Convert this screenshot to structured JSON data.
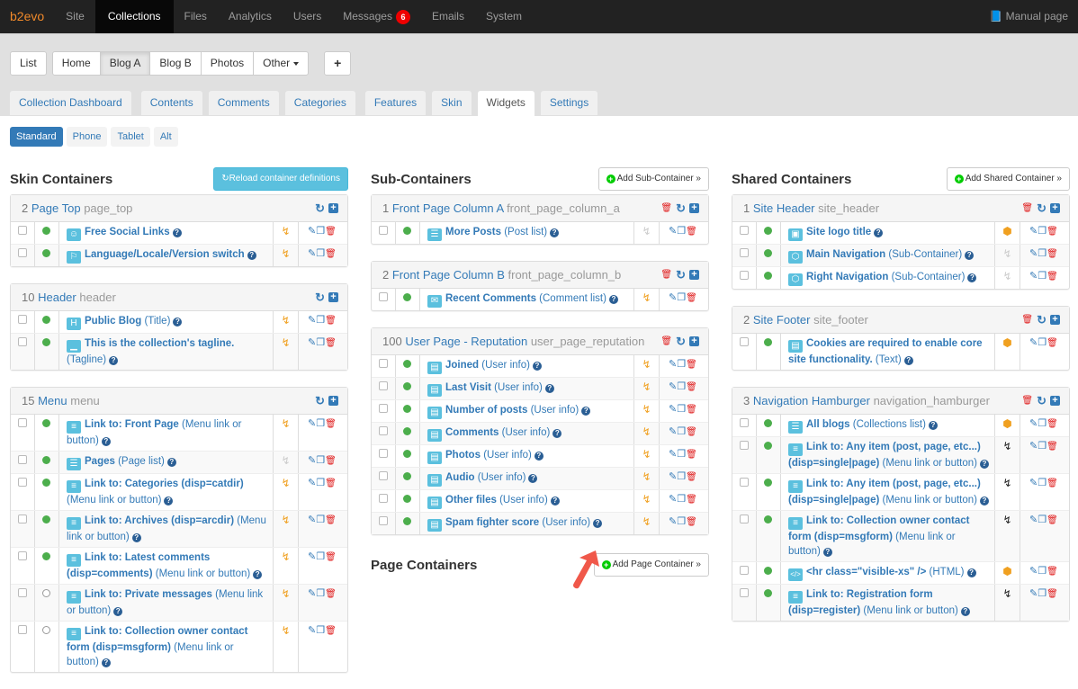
{
  "topnav": {
    "brand": "b2evo",
    "items": [
      {
        "label": "Site"
      },
      {
        "label": "Collections",
        "active": true
      },
      {
        "label": "Files"
      },
      {
        "label": "Analytics"
      },
      {
        "label": "Users"
      },
      {
        "label": "Messages",
        "badge": "6"
      },
      {
        "label": "Emails"
      },
      {
        "label": "System"
      }
    ],
    "manual": "Manual page"
  },
  "collections": {
    "list": "List",
    "items": [
      "Home",
      "Blog A",
      "Blog B",
      "Photos"
    ],
    "active": "Blog A",
    "other": "Other",
    "add": "+"
  },
  "tabs": [
    "Collection Dashboard",
    "Contents",
    "Comments",
    "Categories",
    "Features",
    "Skin",
    "Widgets",
    "Settings"
  ],
  "active_tab": "Widgets",
  "devices": [
    "Standard",
    "Phone",
    "Tablet",
    "Alt"
  ],
  "active_device": "Standard",
  "skin": {
    "title": "Skin Containers",
    "reload_button": "Reload container definitions",
    "panels": [
      {
        "num": "2",
        "name": "Page Top",
        "code": "page_top",
        "deletable": false,
        "widgets": [
          {
            "icon": "social",
            "name": "Free Social Links",
            "type": "",
            "enabled": true,
            "cache": "bolt"
          },
          {
            "icon": "locale",
            "name": "Language/Locale/Version switch",
            "type": "",
            "enabled": true,
            "cache": "bolt"
          }
        ]
      },
      {
        "num": "10",
        "name": "Header",
        "code": "header",
        "deletable": false,
        "widgets": [
          {
            "icon": "H",
            "name": "Public Blog",
            "type": "(Title)",
            "enabled": true,
            "cache": "bolt"
          },
          {
            "icon": "tagline",
            "name": "This is the collection's tagline.",
            "type": "(Tagline)",
            "enabled": true,
            "cache": "bolt"
          }
        ]
      },
      {
        "num": "15",
        "name": "Menu",
        "code": "menu",
        "deletable": false,
        "widgets": [
          {
            "icon": "menu",
            "name": "Link to: Front Page",
            "type": "(Menu link or button)",
            "enabled": true,
            "cache": "bolt"
          },
          {
            "icon": "list",
            "name": "Pages",
            "type": "(Page list)",
            "enabled": true,
            "cache": "bolt-gray"
          },
          {
            "icon": "menu",
            "name": "Link to: Categories (disp=catdir)",
            "type": "(Menu link or button)",
            "enabled": true,
            "cache": "bolt"
          },
          {
            "icon": "menu",
            "name": "Link to: Archives (disp=arcdir)",
            "type": "(Menu link or button)",
            "enabled": true,
            "cache": "bolt"
          },
          {
            "icon": "menu",
            "name": "Link to: Latest comments (disp=comments)",
            "type": "(Menu link or button)",
            "enabled": true,
            "cache": "bolt"
          },
          {
            "icon": "menu",
            "name": "Link to: Private messages",
            "type": "(Menu link or button)",
            "enabled": false,
            "cache": "bolt"
          },
          {
            "icon": "menu",
            "name": "Link to: Collection owner contact form (disp=msgform)",
            "type": "(Menu link or button)",
            "enabled": false,
            "cache": "bolt"
          }
        ]
      }
    ]
  },
  "sub": {
    "title": "Sub-Containers",
    "add_button": "Add Sub-Container »",
    "panels": [
      {
        "num": "1",
        "name": "Front Page Column A",
        "code": "front_page_column_a",
        "deletable": true,
        "widgets": [
          {
            "icon": "list",
            "name": "More Posts",
            "type": "(Post list)",
            "enabled": true,
            "cache": "bolt-gray"
          }
        ]
      },
      {
        "num": "2",
        "name": "Front Page Column B",
        "code": "front_page_column_b",
        "deletable": true,
        "widgets": [
          {
            "icon": "comment",
            "name": "Recent Comments",
            "type": "(Comment list)",
            "enabled": true,
            "cache": "bolt"
          }
        ]
      },
      {
        "num": "100",
        "name": "User Page - Reputation",
        "code": "user_page_reputation",
        "deletable": true,
        "widgets": [
          {
            "icon": "user",
            "name": "Joined",
            "type": "(User info)",
            "enabled": true,
            "cache": "bolt"
          },
          {
            "icon": "user",
            "name": "Last Visit",
            "type": "(User info)",
            "enabled": true,
            "cache": "bolt"
          },
          {
            "icon": "user",
            "name": "Number of posts",
            "type": "(User info)",
            "enabled": true,
            "cache": "bolt"
          },
          {
            "icon": "user",
            "name": "Comments",
            "type": "(User info)",
            "enabled": true,
            "cache": "bolt"
          },
          {
            "icon": "user",
            "name": "Photos",
            "type": "(User info)",
            "enabled": true,
            "cache": "bolt"
          },
          {
            "icon": "user",
            "name": "Audio",
            "type": "(User info)",
            "enabled": true,
            "cache": "bolt"
          },
          {
            "icon": "user",
            "name": "Other files",
            "type": "(User info)",
            "enabled": true,
            "cache": "bolt"
          },
          {
            "icon": "user",
            "name": "Spam fighter score",
            "type": "(User info)",
            "enabled": true,
            "cache": "bolt"
          }
        ]
      }
    ],
    "page_title": "Page Containers",
    "page_add_button": "Add Page Container »"
  },
  "shared": {
    "title": "Shared Containers",
    "add_button": "Add Shared Container »",
    "panels": [
      {
        "num": "1",
        "name": "Site Header",
        "code": "site_header",
        "deletable": true,
        "widgets": [
          {
            "icon": "image",
            "name": "Site logo title",
            "type": "",
            "enabled": true,
            "cache": "cube"
          },
          {
            "icon": "cube",
            "name": "Main Navigation",
            "type": "(Sub-Container)",
            "enabled": true,
            "cache": "bolt-gray"
          },
          {
            "icon": "cube",
            "name": "Right Navigation",
            "type": "(Sub-Container)",
            "enabled": true,
            "cache": "bolt-gray"
          }
        ]
      },
      {
        "num": "2",
        "name": "Site Footer",
        "code": "site_footer",
        "deletable": true,
        "widgets": [
          {
            "icon": "doc",
            "name": "Cookies are required to enable core site functionality.",
            "type": "(Text)",
            "enabled": true,
            "cache": "cube"
          }
        ]
      },
      {
        "num": "3",
        "name": "Navigation Hamburger",
        "code": "navigation_hamburger",
        "deletable": true,
        "widgets": [
          {
            "icon": "list",
            "name": "All blogs",
            "type": "(Collections list)",
            "enabled": true,
            "cache": "cube"
          },
          {
            "icon": "menu",
            "name": "Link to: Any item (post, page, etc...) (disp=single|page)",
            "type": "(Menu link or button)",
            "enabled": true,
            "cache": "bolt-black"
          },
          {
            "icon": "menu",
            "name": "Link to: Any item (post, page, etc...) (disp=single|page)",
            "type": "(Menu link or button)",
            "enabled": true,
            "cache": "bolt-black"
          },
          {
            "icon": "menu",
            "name": "Link to: Collection owner contact form (disp=msgform)",
            "type": "(Menu link or button)",
            "enabled": true,
            "cache": "bolt-black"
          },
          {
            "icon": "code",
            "name": "<hr class=\"visible-xs\" />",
            "type": "(HTML)",
            "enabled": true,
            "cache": "cube"
          },
          {
            "icon": "menu",
            "name": "Link to: Registration form (disp=register)",
            "type": "(Menu link or button)",
            "enabled": true,
            "cache": "bolt-black"
          }
        ]
      }
    ]
  },
  "colors": {
    "link": "#337ab7",
    "brand": "#f0892a",
    "enabled": "#4cae4c",
    "delete": "#e02020",
    "bolt": "#f0a020",
    "reload_btn": "#5bc0de"
  }
}
